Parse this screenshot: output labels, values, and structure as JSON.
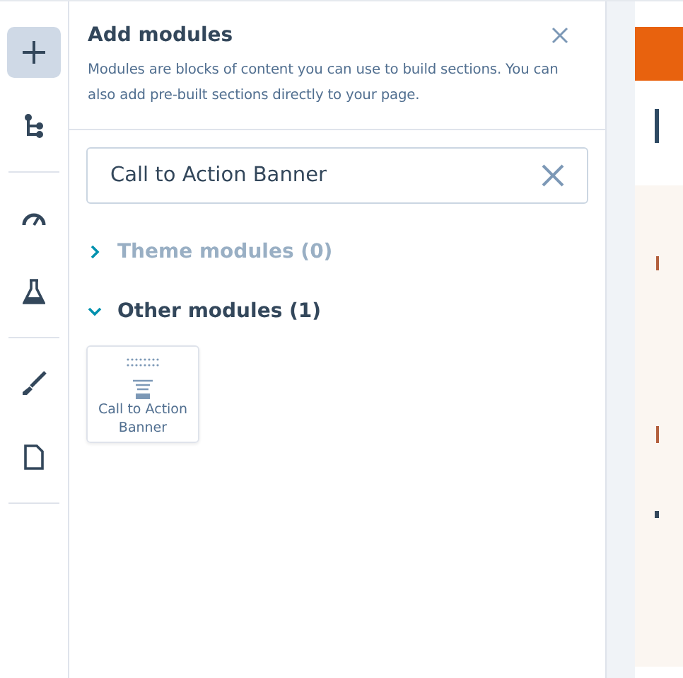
{
  "rail": [
    {
      "kind": "add",
      "selected": true
    },
    {
      "kind": "tree",
      "selected": false,
      "divider": true
    },
    {
      "kind": "gauge",
      "selected": false
    },
    {
      "kind": "flask",
      "selected": false,
      "divider": true
    },
    {
      "kind": "brush",
      "selected": false
    },
    {
      "kind": "page",
      "selected": false,
      "divider": true
    }
  ],
  "panel": {
    "title": "Add modules",
    "description": "Modules are blocks of content you can use to build sections. You can also add pre-built sections directly to your page.",
    "search": {
      "value": "Call to Action Banner"
    },
    "sections": [
      {
        "label": "Theme modules (0)",
        "expanded": false
      },
      {
        "label": "Other modules (1)",
        "expanded": true,
        "modules": [
          {
            "label": "Call to Action Banner"
          }
        ]
      }
    ]
  }
}
